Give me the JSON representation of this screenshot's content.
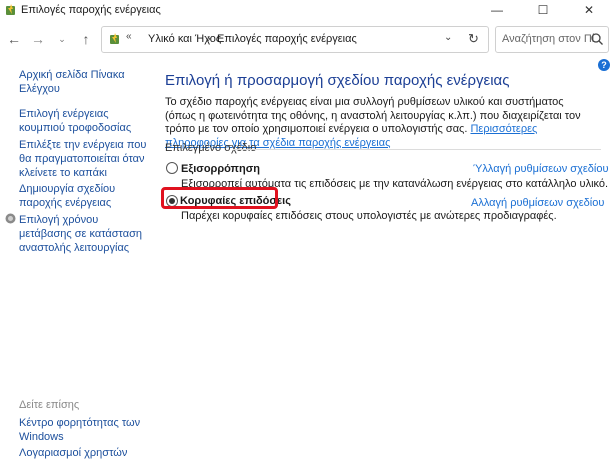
{
  "window": {
    "title": "Επιλογές παροχής ενέργειας",
    "controls": {
      "minimize": "—",
      "maximize": "☐",
      "close": "✕"
    }
  },
  "nav": {
    "back": "←",
    "forward": "→",
    "recent": "⌄",
    "up": "↑",
    "address": {
      "chevron": "«",
      "crumbs": [
        "Υλικό και Ήχος",
        "Επιλογές παροχής ενέργειας"
      ],
      "separator": "›",
      "dropdown": "⌄",
      "refresh": "↻"
    },
    "search": {
      "placeholder": "Αναζήτηση στον Πί..."
    }
  },
  "help": {
    "glyph": "?"
  },
  "sidebar": {
    "links": [
      "Αρχική σελίδα Πίνακα Ελέγχου",
      "Επιλογή ενέργειας κουμπιού τροφοδοσίας",
      "Επιλέξτε την ενέργεια που θα πραγματοποιείται όταν κλείνετε το καπάκι",
      "Δημιουργία σχεδίου παροχής ενέργειας",
      "Επιλογή χρόνου μετάβασης σε κατάσταση αναστολής λειτουργίας"
    ],
    "see_also_label": "Δείτε επίσης",
    "see_also": [
      "Κέντρο φορητότητας των Windows",
      "Λογαριασμοί χρηστών"
    ]
  },
  "main": {
    "title": "Επιλογή ή προσαρμογή σχεδίου παροχής ενέργειας",
    "description": "Το σχέδιο παροχής ενέργειας είναι μια συλλογή ρυθμίσεων υλικού και συστήματος (όπως η φωτεινότητα της οθόνης, η αναστολή λειτουργίας κ.λπ.) που διαχειρίζεται τον τρόπο με τον οποίο χρησιμοποιεί ενέργεια ο υπολογιστής σας.",
    "more_link": "Περισσότερες πληροφορίες για τα σχέδια παροχής ενέργειας",
    "section_label": "Επιλεγμένο σχέδιο",
    "plans": [
      {
        "name": "Εξισορρόπηση",
        "description": "Εξισορροπεί αυτόματα τις επιδόσεις με την κατανάλωση ενέργειας στο κατάλληλο υλικό.",
        "link": "Ύλλαγή ρυθμίσεων σχεδίου",
        "selected": false
      },
      {
        "name": "Κορυφαίες επιδόσεις",
        "description": "Παρέχει κορυφαίες επιδόσεις στους υπολογιστές με ανώτερες προδιαγραφές.",
        "link": "Αλλαγή ρυθμίσεων σχεδίου",
        "selected": true
      }
    ]
  },
  "colors": {
    "link": "#1a6fd4",
    "sidebar_link": "#1c4f9c",
    "title": "#1c3f95",
    "highlight": "#e0121f"
  },
  "icons": [
    "power-options-icon",
    "search-icon",
    "shield-icon",
    "help-icon"
  ]
}
